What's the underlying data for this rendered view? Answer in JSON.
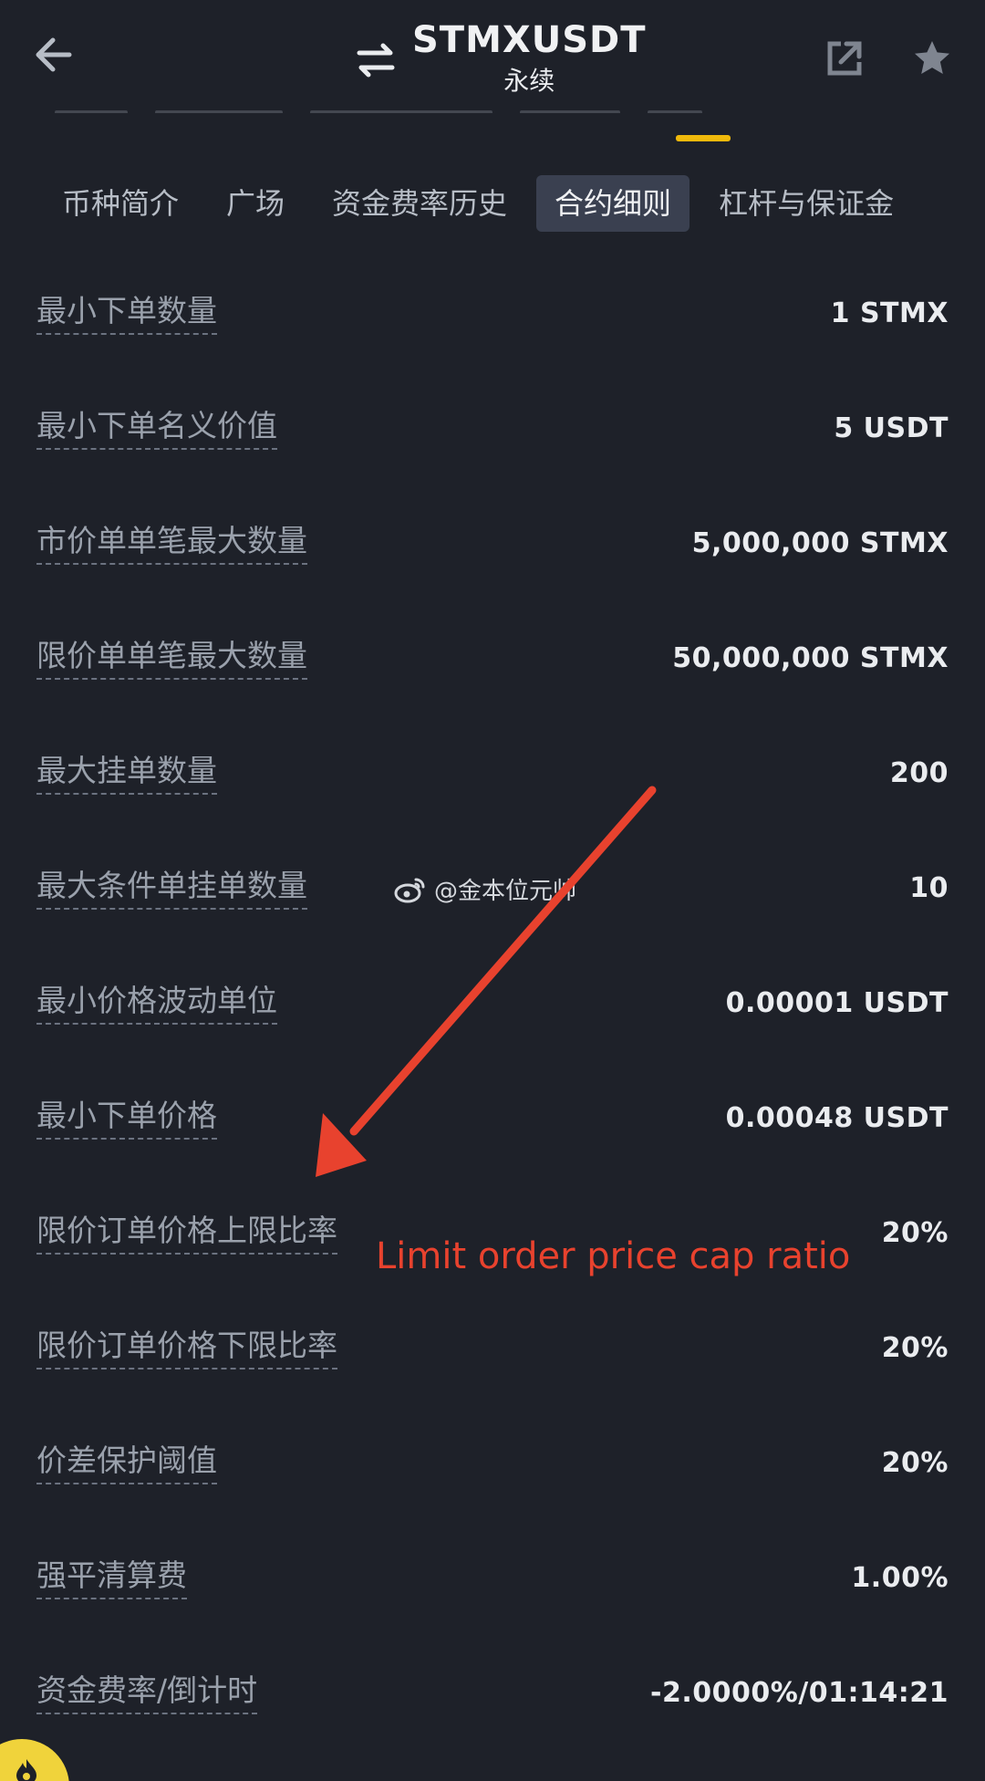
{
  "header": {
    "symbol": "STMXUSDT",
    "subtitle": "永续",
    "icons": [
      "back-arrow-icon",
      "swap-icon",
      "share-icon",
      "star-icon"
    ]
  },
  "tabs": [
    {
      "label": "币种简介",
      "active": false
    },
    {
      "label": "广场",
      "active": false
    },
    {
      "label": "资金费率历史",
      "active": false
    },
    {
      "label": "合约细则",
      "active": true
    },
    {
      "label": "杠杆与保证金",
      "active": false
    }
  ],
  "specs": [
    {
      "label": "最小下单数量",
      "value": "1 STMX"
    },
    {
      "label": "最小下单名义价值",
      "value": "5 USDT"
    },
    {
      "label": "市价单单笔最大数量",
      "value": "5,000,000 STMX"
    },
    {
      "label": "限价单单笔最大数量",
      "value": "50,000,000 STMX"
    },
    {
      "label": "最大挂单数量",
      "value": "200"
    },
    {
      "label": "最大条件单挂单数量",
      "value": "10"
    },
    {
      "label": "最小价格波动单位",
      "value": "0.00001 USDT"
    },
    {
      "label": "最小下单价格",
      "value": "0.00048 USDT"
    },
    {
      "label": "限价订单价格上限比率",
      "value": "20%"
    },
    {
      "label": "限价订单价格下限比率",
      "value": "20%"
    },
    {
      "label": "价差保护阈值",
      "value": "20%"
    },
    {
      "label": "强平清算费",
      "value": "1.00%"
    },
    {
      "label": "资金费率/倒计时",
      "value": "-2.0000%/01:14:21"
    }
  ],
  "watermark": "@金本位元帅",
  "annotation": "Limit order price cap ratio",
  "colors": {
    "background": "#1e2129",
    "accent": "#f0b90b",
    "annotation": "#e8422e"
  }
}
